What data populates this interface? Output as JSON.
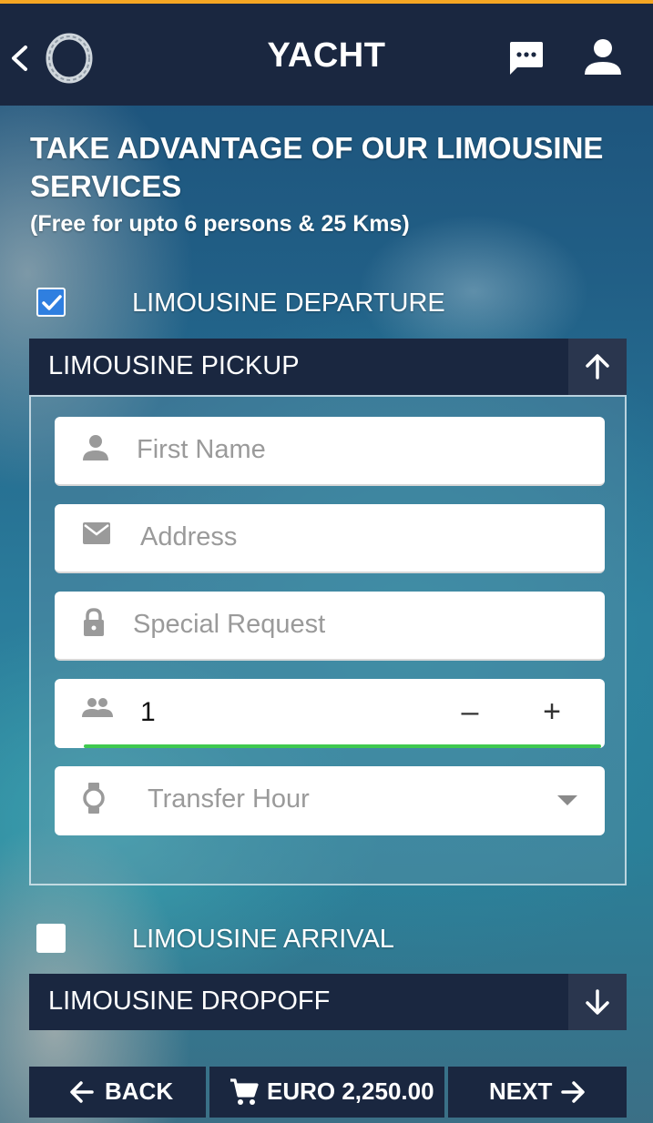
{
  "header": {
    "title": "YACHT",
    "icons": [
      "chevron-left-icon",
      "logo-ring-icon",
      "chat-icon",
      "user-icon"
    ]
  },
  "intro": {
    "headline": "TAKE ADVANTAGE OF OUR LIMOUSINE SERVICES",
    "subline": "(Free for upto 6 persons & 25 Kms)"
  },
  "departure": {
    "checkbox_label": "LIMOUSINE DEPARTURE",
    "checked": true,
    "section_title": "LIMOUSINE PICKUP",
    "expanded": true,
    "fields": {
      "first_name_placeholder": "First Name",
      "address_placeholder": "Address",
      "special_request_placeholder": "Special Request",
      "persons_value": "1",
      "minus_label": "–",
      "plus_label": "+",
      "transfer_hour_placeholder": "Transfer Hour"
    }
  },
  "arrival": {
    "checkbox_label": "LIMOUSINE ARRIVAL",
    "checked": false,
    "section_title": "LIMOUSINE DROPOFF",
    "expanded": false
  },
  "footer": {
    "back_label": "BACK",
    "price_label": "EURO 2,250.00",
    "next_label": "NEXT"
  },
  "colors": {
    "accent_top": "#f5a623",
    "navy": "#1a2740",
    "checkbox_blue": "#2f7fe0",
    "focus_green": "#3fc94f"
  }
}
